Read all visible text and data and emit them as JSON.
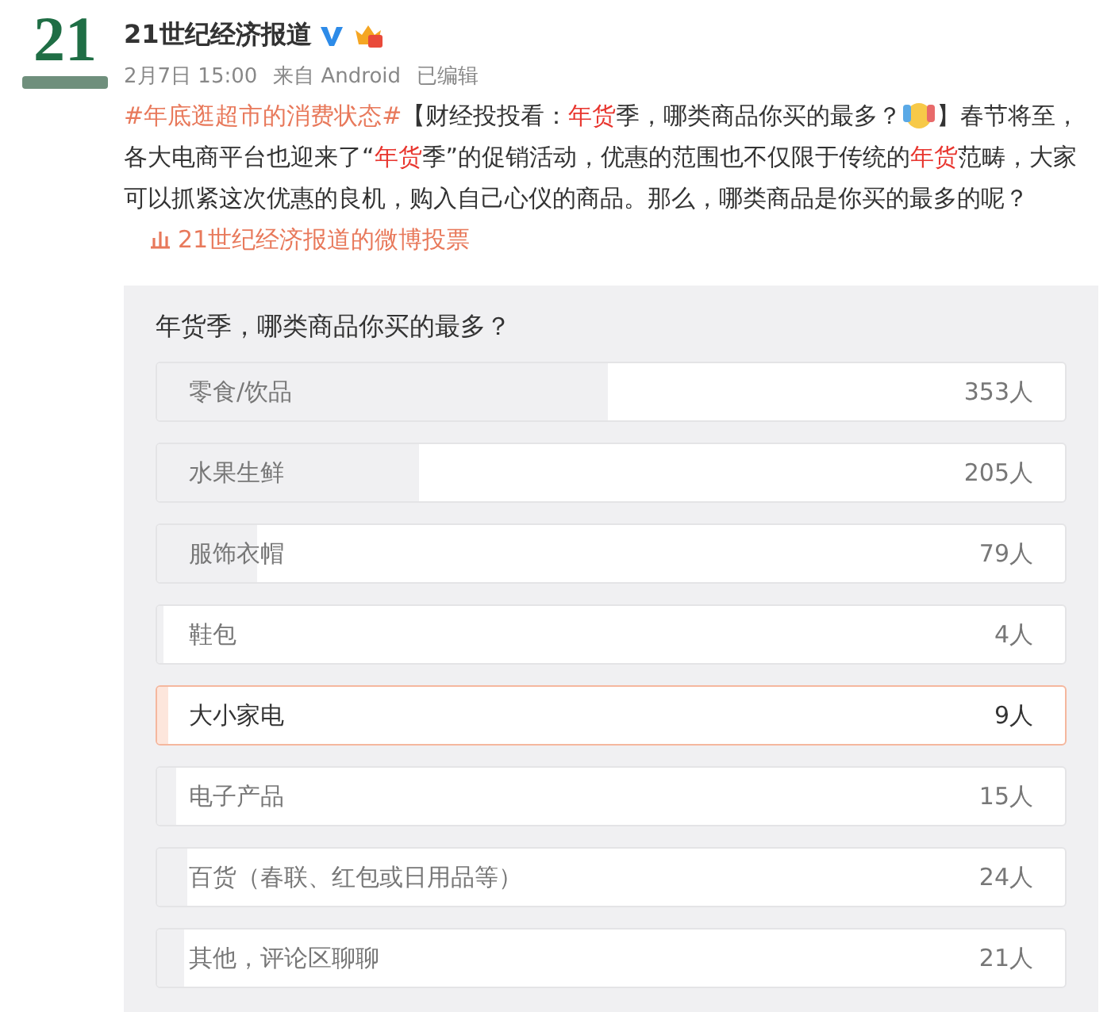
{
  "account": {
    "logo_text": "21",
    "name": "21世纪经济报道",
    "verified": true,
    "meta": [
      "2月7日 15:00",
      "来自 Android",
      "已编辑"
    ]
  },
  "post": {
    "segments": [
      {
        "kind": "hashtag",
        "text": "#年底逛超市的消费状态#"
      },
      {
        "kind": "text",
        "text": "【财经投投看："
      },
      {
        "kind": "keyword",
        "text": "年货"
      },
      {
        "kind": "text",
        "text": "季，哪类商品你买的最多？"
      },
      {
        "kind": "emoji"
      },
      {
        "kind": "text",
        "text": "】春节将至，各大电商平台也迎来了“"
      },
      {
        "kind": "keyword",
        "text": "年货"
      },
      {
        "kind": "text",
        "text": "季”的促销活动，优惠的范围也不仅限于传统的"
      },
      {
        "kind": "keyword",
        "text": "年货"
      },
      {
        "kind": "text",
        "text": "范畴，大家可以抓紧这次优惠的良机，购入自己心仪的商品。那么，哪类商品是你买的最多的呢？"
      },
      {
        "kind": "link",
        "text": "21世纪经济报道的微博投票"
      }
    ]
  },
  "poll": {
    "question": "年货季，哪类商品你买的最多？",
    "options": [
      {
        "label": "零食/饮品",
        "count": "353人",
        "level": 0.497,
        "selected": false
      },
      {
        "label": "水果生鲜",
        "count": "205人",
        "level": 0.289,
        "selected": false
      },
      {
        "label": "服饰衣帽",
        "count": "79人",
        "level": 0.111,
        "selected": false
      },
      {
        "label": "鞋包",
        "count": "4人",
        "level": 0.006,
        "selected": false
      },
      {
        "label": "大小家电",
        "count": "9人",
        "level": 0.013,
        "selected": true
      },
      {
        "label": "电子产品",
        "count": "15人",
        "level": 0.021,
        "selected": false
      },
      {
        "label": "百货（春联、红包或日用品等）",
        "count": "24人",
        "level": 0.034,
        "selected": false
      },
      {
        "label": "其他，评论区聊聊",
        "count": "21人",
        "level": 0.03,
        "selected": false
      }
    ]
  }
}
